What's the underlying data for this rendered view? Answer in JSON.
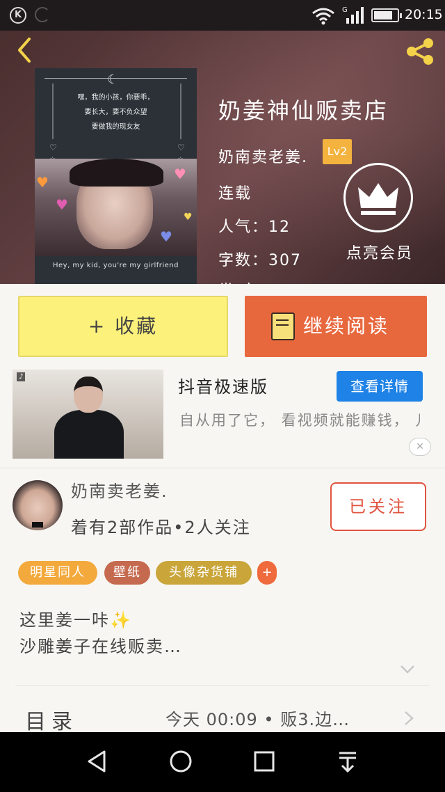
{
  "status_bar": {
    "k_icon": "K",
    "network_type": "G",
    "battery_level": 0.8,
    "time": "20:15"
  },
  "header": {
    "back_icon": "chevron-left-icon",
    "share_icon": "share-icon",
    "cover": {
      "moon": "☾",
      "poem_lines": [
        "嘿，我的小孩，你要乖，",
        "要长大，要不负众望",
        "要做我的现女友"
      ],
      "caption": "Hey, my kid, you're my girlfriend"
    },
    "book_title": "奶姜神仙贩卖店",
    "author_name": "奶南卖老姜.",
    "level": "Lv2",
    "status": "连载",
    "popularity_label": "人气：",
    "popularity_value": "12",
    "word_count_label": "字数：",
    "word_count_value": "307",
    "partial_line": "类 字",
    "vip_label": "点亮会员",
    "accent_color": "#f3b33e"
  },
  "actions": {
    "collect_label": "+ 收藏",
    "read_label": "继续阅读",
    "collect_color": "#fbf17b",
    "read_color": "#e8683e"
  },
  "ad": {
    "thumb_logo": "♪",
    "title": "抖音极速版",
    "detail_button": "查看详情",
    "description": "自从用了它， 看视频就能赚钱， 几十块钱轻松进账，",
    "close_label": "✕"
  },
  "author": {
    "name": "奶南卖老姜.",
    "stats": "着有2部作品•2人关注",
    "follow_label": "已关注"
  },
  "tags": [
    {
      "label": "明星同人",
      "color": "#f3a93c"
    },
    {
      "label": "壁纸",
      "color": "#c56a4f"
    },
    {
      "label": "头像杂货铺",
      "color": "#c9a53a"
    },
    {
      "label": "+",
      "color": "#ef6a3c"
    }
  ],
  "intro": {
    "line1": "这里姜一咔",
    "sparkle": "✨",
    "line2": "沙雕姜子在线贩卖…"
  },
  "catalog": {
    "label": "目录",
    "latest": "今天 00:09 • 贩3.边…"
  },
  "nav": {
    "back_icon": "triangle-back-icon",
    "home_icon": "circle-home-icon",
    "recents_icon": "square-recents-icon",
    "notify_icon": "pull-down-icon"
  }
}
